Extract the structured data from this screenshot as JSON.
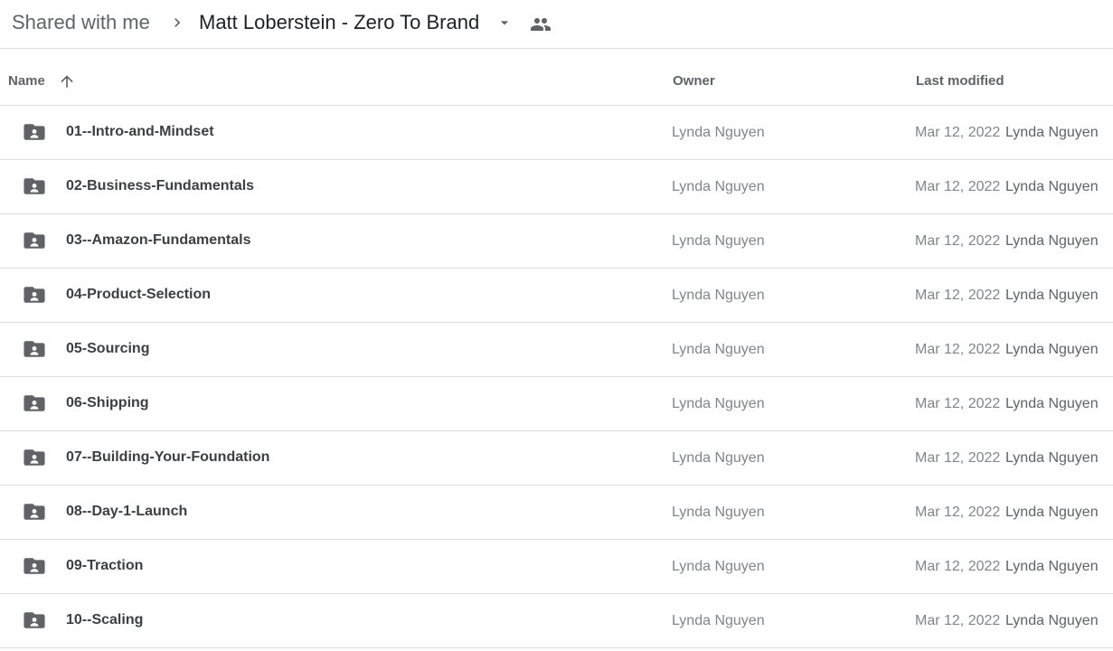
{
  "breadcrumb": {
    "root": "Shared with me",
    "current": "Matt Loberstein - Zero To Brand"
  },
  "columns": {
    "name": "Name",
    "owner": "Owner",
    "last_modified": "Last modified"
  },
  "colors": {
    "icon": "#5f6368",
    "divider": "#dadce0",
    "secondary_text": "#80868b"
  },
  "files": [
    {
      "name": "01--Intro-and-Mindset",
      "owner": "Lynda Nguyen",
      "modified_date": "Mar 12, 2022",
      "modified_by": "Lynda Nguyen",
      "icon": "shared-folder-icon"
    },
    {
      "name": "02-Business-Fundamentals",
      "owner": "Lynda Nguyen",
      "modified_date": "Mar 12, 2022",
      "modified_by": "Lynda Nguyen",
      "icon": "shared-folder-icon"
    },
    {
      "name": "03--Amazon-Fundamentals",
      "owner": "Lynda Nguyen",
      "modified_date": "Mar 12, 2022",
      "modified_by": "Lynda Nguyen",
      "icon": "shared-folder-icon"
    },
    {
      "name": "04-Product-Selection",
      "owner": "Lynda Nguyen",
      "modified_date": "Mar 12, 2022",
      "modified_by": "Lynda Nguyen",
      "icon": "shared-folder-icon"
    },
    {
      "name": "05-Sourcing",
      "owner": "Lynda Nguyen",
      "modified_date": "Mar 12, 2022",
      "modified_by": "Lynda Nguyen",
      "icon": "shared-folder-icon"
    },
    {
      "name": "06-Shipping",
      "owner": "Lynda Nguyen",
      "modified_date": "Mar 12, 2022",
      "modified_by": "Lynda Nguyen",
      "icon": "shared-folder-icon"
    },
    {
      "name": "07--Building-Your-Foundation",
      "owner": "Lynda Nguyen",
      "modified_date": "Mar 12, 2022",
      "modified_by": "Lynda Nguyen",
      "icon": "shared-folder-icon"
    },
    {
      "name": "08--Day-1-Launch",
      "owner": "Lynda Nguyen",
      "modified_date": "Mar 12, 2022",
      "modified_by": "Lynda Nguyen",
      "icon": "shared-folder-icon"
    },
    {
      "name": "09-Traction",
      "owner": "Lynda Nguyen",
      "modified_date": "Mar 12, 2022",
      "modified_by": "Lynda Nguyen",
      "icon": "shared-folder-icon"
    },
    {
      "name": "10--Scaling",
      "owner": "Lynda Nguyen",
      "modified_date": "Mar 12, 2022",
      "modified_by": "Lynda Nguyen",
      "icon": "shared-folder-icon"
    }
  ]
}
